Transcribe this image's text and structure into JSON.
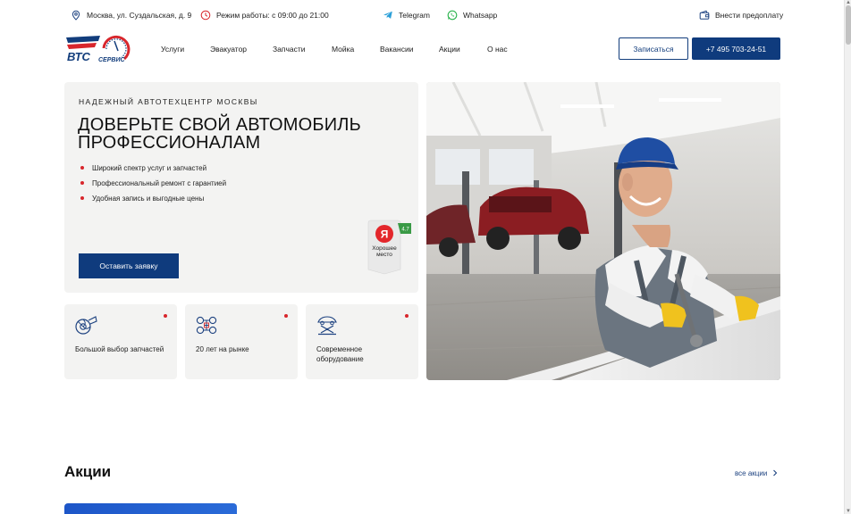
{
  "topbar": {
    "address": "Москва, ул. Суздальская, д. 9",
    "hours": "Режим работы: с 09:00 до 21:00",
    "telegram": "Telegram",
    "whatsapp": "Whatsapp",
    "prepay": "Внести предоплату",
    "icons": {
      "address": "map-pin-icon",
      "hours": "clock-icon",
      "telegram": "telegram-icon",
      "whatsapp": "whatsapp-icon",
      "prepay": "wallet-icon"
    }
  },
  "header": {
    "logo_text": "ВТС СЕРВИС",
    "nav": [
      "Услуги",
      "Эвакуатор",
      "Запчасти",
      "Мойка",
      "Вакансии",
      "Акции",
      "О нас"
    ],
    "signup_label": "Записаться",
    "phone_label": "+7 495 703-24-51"
  },
  "hero": {
    "kicker": "Надежный автотехцентр Москвы",
    "title": "Доверьте свой автомобиль профессионалам",
    "bullets": [
      "Широкий спектр услуг и запчастей",
      "Профессиональный ремонт с гарантией",
      "Удобная запись и выгодные цены"
    ],
    "cta_label": "Оставить заявку",
    "badge": {
      "letter": "Я",
      "text_line1": "Хорошее",
      "text_line2": "место",
      "rating": "4.7"
    }
  },
  "features": [
    {
      "text": "Большой выбор запчастей",
      "icon": "turbocharger-icon"
    },
    {
      "text": "20 лет на рынке",
      "icon": "car-chassis-icon"
    },
    {
      "text": "Современное оборудование",
      "icon": "car-lift-icon"
    }
  ],
  "promo": {
    "title": "Акции",
    "all_link": "все акции"
  },
  "colors": {
    "brand_blue": "#0f3b7d",
    "accent_red": "#d8262c",
    "card_bg": "#f3f3f2"
  }
}
